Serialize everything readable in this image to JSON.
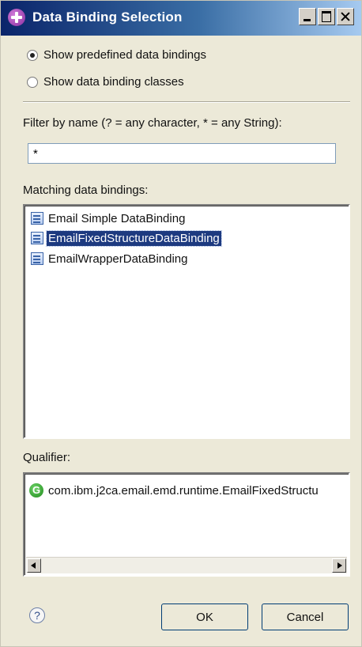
{
  "window": {
    "title": "Data Binding Selection",
    "minimize_icon": "minimize-icon",
    "maximize_icon": "maximize-icon",
    "close_icon": "close-icon"
  },
  "options": {
    "radio_predefined": {
      "label": "Show predefined data bindings",
      "selected": true
    },
    "radio_classes": {
      "label": "Show data binding classes",
      "selected": false
    }
  },
  "filter": {
    "label": "Filter by name (? = any character, * = any String):",
    "value": "*"
  },
  "matching": {
    "label": "Matching data bindings:",
    "items": [
      {
        "label": "Email Simple DataBinding",
        "selected": false,
        "icon": "databinding-icon"
      },
      {
        "label": "EmailFixedStructureDataBinding",
        "selected": true,
        "icon": "databinding-icon"
      },
      {
        "label": "EmailWrapperDataBinding",
        "selected": false,
        "icon": "databinding-icon"
      }
    ]
  },
  "qualifier": {
    "label": "Qualifier:",
    "value": "com.ibm.j2ca.email.emd.runtime.EmailFixedStructu",
    "icon": "class-icon",
    "icon_glyph": "G"
  },
  "footer": {
    "help_icon": "help-icon",
    "help_glyph": "?",
    "ok_label": "OK",
    "cancel_label": "Cancel"
  },
  "colors": {
    "selection": "#1d3a80",
    "title_bar_start": "#0a246a",
    "title_bar_end": "#a6caf0"
  }
}
